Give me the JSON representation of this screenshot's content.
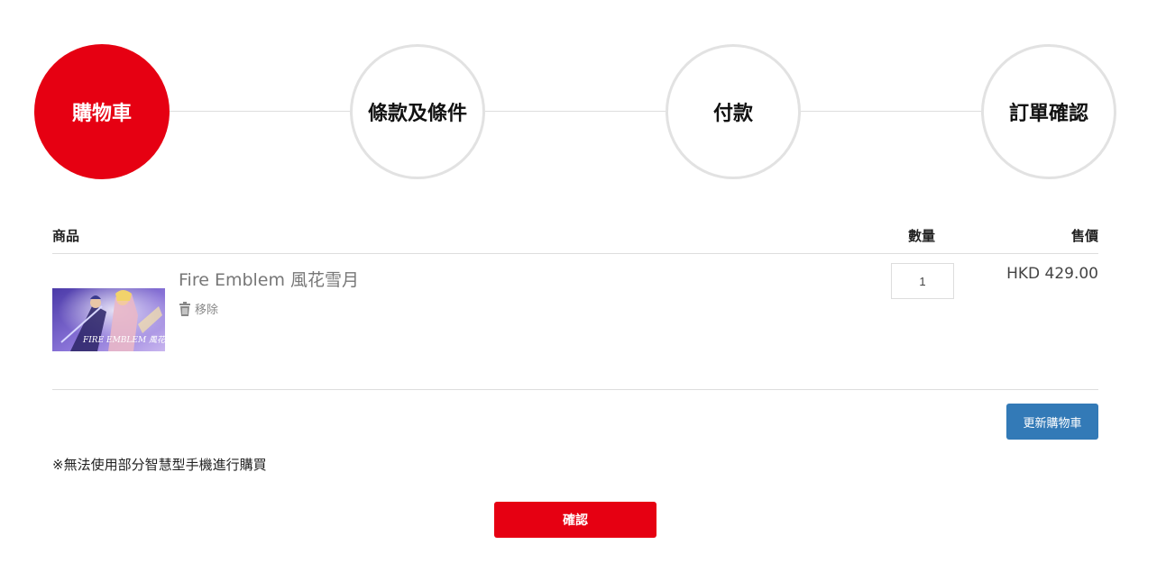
{
  "steps": [
    {
      "label": "購物車",
      "active": true
    },
    {
      "label": "條款及條件",
      "active": false
    },
    {
      "label": "付款",
      "active": false
    },
    {
      "label": "訂單確認",
      "active": false
    }
  ],
  "cart": {
    "headers": {
      "product": "商品",
      "quantity": "數量",
      "price": "售價"
    },
    "items": [
      {
        "name": "Fire Emblem 風花雪月",
        "remove_label": "移除",
        "remove_icon": "trash-icon",
        "quantity": "1",
        "price": "HKD 429.00",
        "thumbnail_text": "FIRE EMBLEM 風花雪月"
      }
    ],
    "update_label": "更新購物車"
  },
  "note": "※無法使用部分智慧型手機進行購買",
  "confirm_label": "確認",
  "colors": {
    "accent": "#e60012",
    "update_button": "#337ab7",
    "step_border": "#e2e2e2"
  }
}
